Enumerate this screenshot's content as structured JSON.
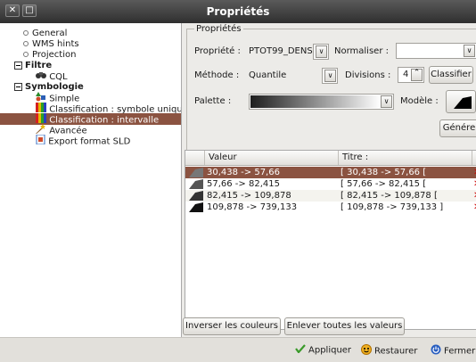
{
  "window": {
    "title": "Propriétés",
    "close_glyph": "✕",
    "restore_glyph": "□"
  },
  "sidebar": {
    "items": [
      {
        "label": "General"
      },
      {
        "label": "WMS hints"
      },
      {
        "label": "Projection"
      },
      {
        "label": "Filtre"
      },
      {
        "label": "CQL"
      },
      {
        "label": "Symbologie"
      },
      {
        "label": "Simple"
      },
      {
        "label": "Classification : symbole unique"
      },
      {
        "label": "Classification : intervalle"
      },
      {
        "label": "Avancée"
      },
      {
        "label": "Export format SLD"
      }
    ]
  },
  "props": {
    "legend": "Propriétés",
    "property_label": "Propriété :",
    "property_value": "PTOT99_DENS",
    "normalize_label": "Normaliser :",
    "normalize_value": "",
    "method_label": "Méthode :",
    "method_value": "Quantile",
    "divisions_label": "Divisions :",
    "divisions_value": "4",
    "classify_button": "Classifier",
    "palette_label": "Palette :",
    "model_label": "Modèle :",
    "generate_button": "Génére",
    "arrow_glyph": "∨",
    "spin_up_glyph": "⌃",
    "spin_down_glyph": "⌄"
  },
  "table": {
    "columns": [
      "Valeur",
      "Titre :"
    ],
    "rows": [
      {
        "value": "30,438 -> 57,66",
        "title": "[ 30,438 -> 57,66 [",
        "color": "#777777"
      },
      {
        "value": "57,66 -> 82,415",
        "title": "[ 57,66 -> 82,415 [",
        "color": "#555555"
      },
      {
        "value": "82,415 -> 109,878",
        "title": "[ 82,415 -> 109,878 [",
        "color": "#333333"
      },
      {
        "value": "109,878 -> 739,133",
        "title": "[ 109,878 -> 739,133 ]",
        "color": "#111111"
      }
    ],
    "delete_glyph": "✕"
  },
  "actions": {
    "invert_button": "Inverser les couleurs",
    "clear_button": "Enlever toutes les valeurs"
  },
  "status": {
    "apply": "Appliquer",
    "restore": "Restaurer",
    "close": "Fermer"
  }
}
